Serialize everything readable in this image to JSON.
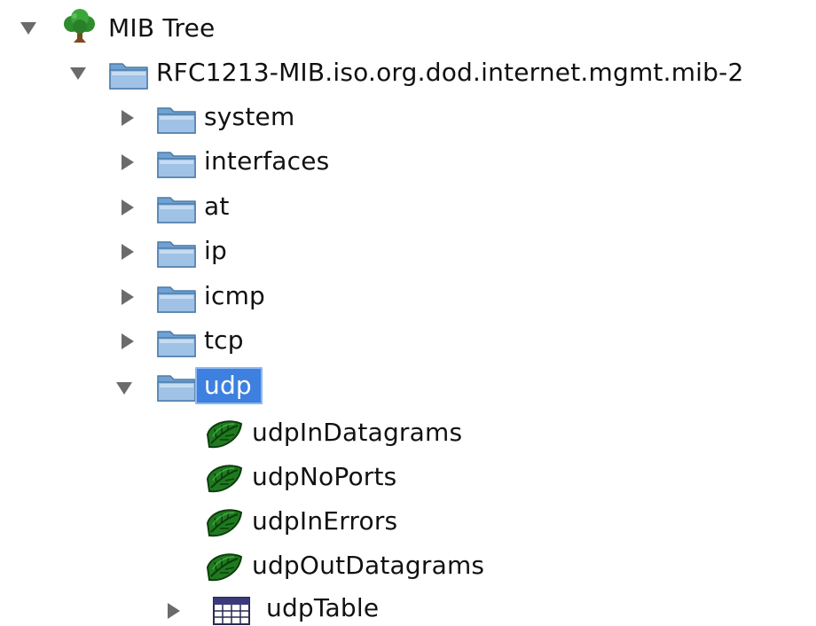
{
  "tree": {
    "root": {
      "label": "MIB Tree",
      "icon": "tree-icon",
      "expanded": true
    },
    "mib2": {
      "label": "RFC1213-MIB.iso.org.dod.internet.mgmt.mib-2",
      "icon": "folder-icon",
      "expanded": true
    },
    "groups": [
      {
        "label": "system",
        "icon": "folder-icon",
        "expanded": false
      },
      {
        "label": "interfaces",
        "icon": "folder-icon",
        "expanded": false
      },
      {
        "label": "at",
        "icon": "folder-icon",
        "expanded": false
      },
      {
        "label": "ip",
        "icon": "folder-icon",
        "expanded": false
      },
      {
        "label": "icmp",
        "icon": "folder-icon",
        "expanded": false
      },
      {
        "label": "tcp",
        "icon": "folder-icon",
        "expanded": false
      },
      {
        "label": "udp",
        "icon": "folder-icon",
        "expanded": true,
        "selected": true
      }
    ],
    "udp_children": [
      {
        "label": "udpInDatagrams",
        "icon": "leaf-icon"
      },
      {
        "label": "udpNoPorts",
        "icon": "leaf-icon"
      },
      {
        "label": "udpInErrors",
        "icon": "leaf-icon"
      },
      {
        "label": "udpOutDatagrams",
        "icon": "leaf-icon"
      }
    ],
    "udp_table": {
      "label": "udpTable",
      "icon": "table-icon",
      "expanded": false
    }
  },
  "colors": {
    "selection_bg": "#3d80df",
    "folder": "#9fc2e6",
    "leaf": "#1f7a1f",
    "toggle": "#6b6b6b"
  }
}
